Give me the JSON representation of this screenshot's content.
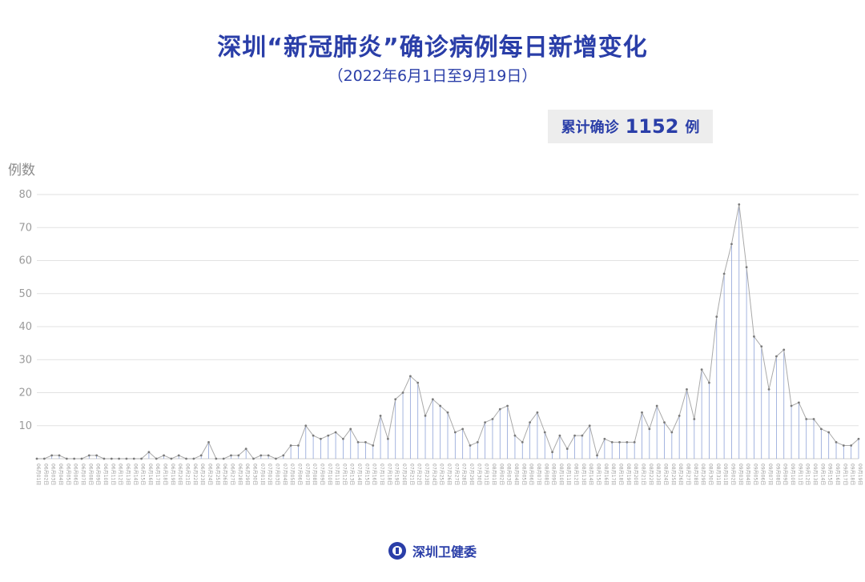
{
  "header": {
    "title": "深圳“新冠肺炎”确诊病例每日新增变化",
    "subtitle": "（2022年6月1日至9月19日）"
  },
  "total": {
    "label": "累计确诊",
    "value": "1152",
    "unit": "例"
  },
  "footer": {
    "org": "深圳卫健委",
    "logo_icon": "health-commission-logo-icon"
  },
  "colors": {
    "title": "#2a3ea8",
    "line": "#8fa3d8",
    "marker": "#7a7a7a",
    "grid": "#e2e2e2",
    "axis_text": "#9a9a9a"
  },
  "chart_data": {
    "type": "line",
    "ylabel": "例数",
    "ylim": [
      0,
      80
    ],
    "yticks": [
      10,
      20,
      30,
      40,
      50,
      60,
      70,
      80
    ],
    "grid": true,
    "x_start": "2022-06-01",
    "x": [
      "06月01日",
      "06月02日",
      "06月03日",
      "06月04日",
      "06月05日",
      "06月06日",
      "06月07日",
      "06月08日",
      "06月09日",
      "06月10日",
      "06月11日",
      "06月12日",
      "06月13日",
      "06月14日",
      "06月15日",
      "06月16日",
      "06月17日",
      "06月18日",
      "06月19日",
      "06月20日",
      "06月21日",
      "06月22日",
      "06月23日",
      "06月24日",
      "06月25日",
      "06月26日",
      "06月27日",
      "06月28日",
      "06月29日",
      "06月30日",
      "07月01日",
      "07月02日",
      "07月03日",
      "07月04日",
      "07月05日",
      "07月06日",
      "07月07日",
      "07月08日",
      "07月09日",
      "07月10日",
      "07月11日",
      "07月12日",
      "07月13日",
      "07月14日",
      "07月15日",
      "07月16日",
      "07月17日",
      "07月18日",
      "07月19日",
      "07月20日",
      "07月21日",
      "07月22日",
      "07月23日",
      "07月24日",
      "07月25日",
      "07月26日",
      "07月27日",
      "07月28日",
      "07月29日",
      "07月30日",
      "07月31日",
      "08月01日",
      "08月02日",
      "08月03日",
      "08月04日",
      "08月05日",
      "08月06日",
      "08月07日",
      "08月08日",
      "08月09日",
      "08月10日",
      "08月11日",
      "08月12日",
      "08月13日",
      "08月14日",
      "08月15日",
      "08月16日",
      "08月17日",
      "08月18日",
      "08月19日",
      "08月20日",
      "08月21日",
      "08月22日",
      "08月23日",
      "08月24日",
      "08月25日",
      "08月26日",
      "08月27日",
      "08月28日",
      "08月29日",
      "08月30日",
      "08月31日",
      "09月01日",
      "09月02日",
      "09月03日",
      "09月04日",
      "09月05日",
      "09月06日",
      "09月07日",
      "09月08日",
      "09月09日",
      "09月10日",
      "09月11日",
      "09月12日",
      "09月13日",
      "09月14日",
      "09月15日",
      "09月16日",
      "09月17日",
      "09月18日",
      "09月19日"
    ],
    "values": [
      0,
      0,
      1,
      1,
      0,
      0,
      0,
      1,
      1,
      0,
      0,
      0,
      0,
      0,
      0,
      2,
      0,
      1,
      0,
      1,
      0,
      0,
      1,
      5,
      0,
      0,
      1,
      1,
      3,
      0,
      1,
      1,
      0,
      1,
      4,
      4,
      10,
      7,
      6,
      7,
      8,
      6,
      9,
      5,
      5,
      4,
      13,
      6,
      18,
      20,
      25,
      23,
      13,
      18,
      16,
      14,
      8,
      9,
      4,
      5,
      11,
      12,
      15,
      16,
      7,
      5,
      11,
      14,
      8,
      2,
      7,
      3,
      7,
      7,
      10,
      1,
      6,
      5,
      5,
      5,
      5,
      14,
      9,
      16,
      11,
      8,
      13,
      21,
      12,
      27,
      23,
      43,
      56,
      65,
      77,
      58,
      37,
      34,
      21,
      31,
      33,
      16,
      17,
      12,
      12,
      9,
      8,
      5,
      4,
      4,
      6
    ],
    "series": [
      {
        "values_ref": "values"
      }
    ]
  }
}
